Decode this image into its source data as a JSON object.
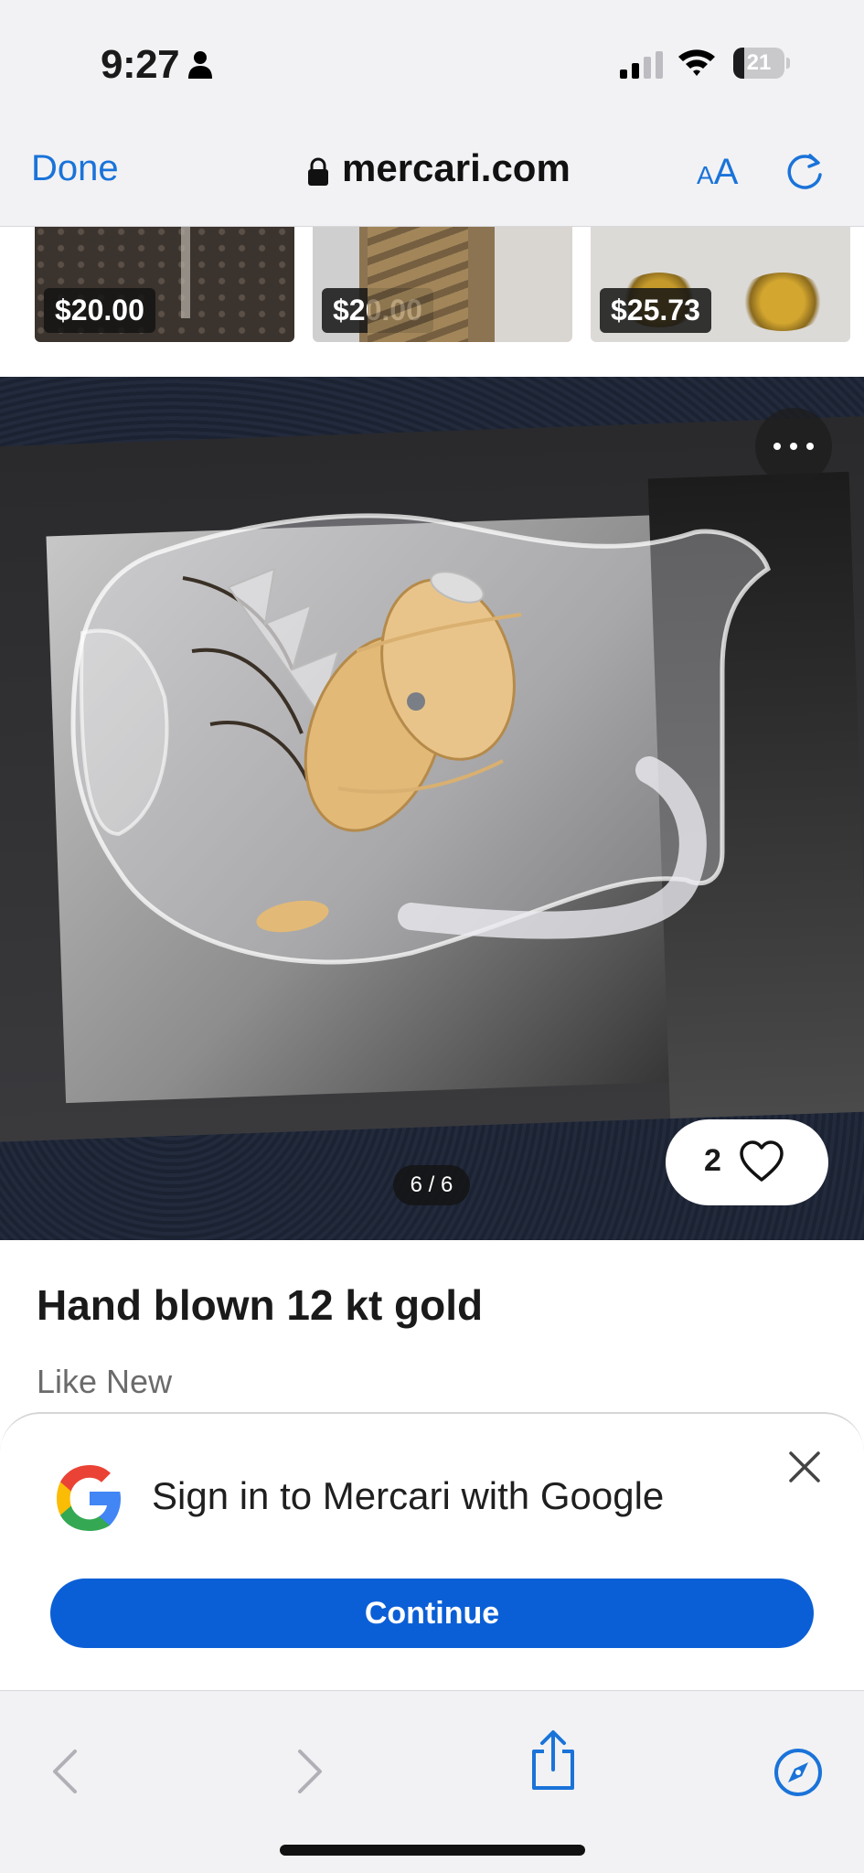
{
  "status_bar": {
    "time": "9:27",
    "battery_level": "21",
    "icons": [
      "person-icon",
      "signal-icon",
      "wifi-icon",
      "battery-icon"
    ]
  },
  "browser": {
    "done_label": "Done",
    "url": "mercari.com",
    "text_size_small": "A",
    "text_size_large": "A",
    "accent_color": "#1a73d9"
  },
  "thumbnails": [
    {
      "price": "$20.00"
    },
    {
      "price": "$20.00"
    },
    {
      "price": "$25.73"
    }
  ],
  "photo": {
    "counter": "6 / 6",
    "likes": "2"
  },
  "item": {
    "title": "Hand blown 12 kt gold",
    "condition": "Like New"
  },
  "signin": {
    "text": "Sign in to Mercari with Google",
    "continue_label": "Continue",
    "button_color": "#0b5fd6"
  }
}
